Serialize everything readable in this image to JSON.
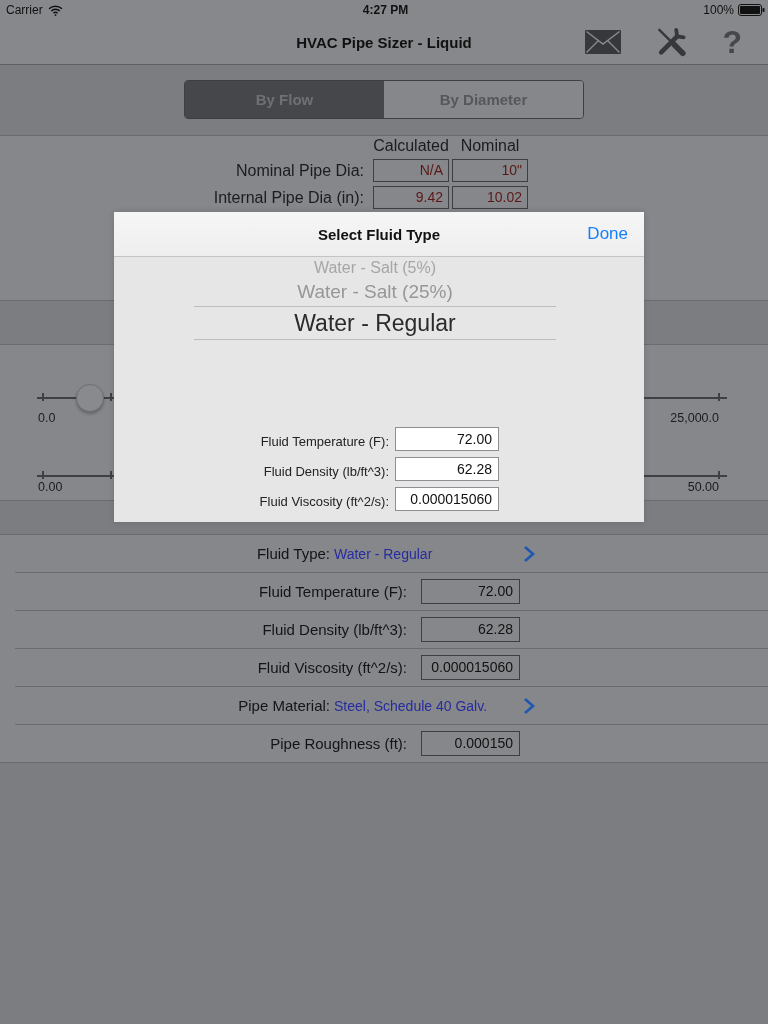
{
  "status_bar": {
    "carrier": "Carrier",
    "time": "4:27 PM",
    "battery": "100%"
  },
  "nav_bar": {
    "title": "HVAC Pipe Sizer - Liquid",
    "help_button": "?"
  },
  "mode_tabs": [
    {
      "label": "By Flow",
      "selected": true
    },
    {
      "label": "By Diameter",
      "selected": false
    }
  ],
  "diameter_table": {
    "columns": [
      "Calculated",
      "Nominal"
    ],
    "rows": [
      {
        "label": "Nominal Pipe Dia:",
        "cells": [
          "N/A",
          "10\""
        ]
      },
      {
        "label": "Internal Pipe Dia (in):",
        "cells": [
          "9.42",
          "10.02"
        ]
      }
    ]
  },
  "sliders": [
    {
      "level": 0.07,
      "min_label": "0.0",
      "max_label": "25,000.0"
    },
    {
      "min_label": "0.00",
      "max_label": "50.00"
    }
  ],
  "fluid_list": [
    {
      "kind": "link",
      "label": "Fluid Type:",
      "value": "Water - Regular"
    },
    {
      "kind": "field",
      "label": "Fluid Temperature (F):",
      "value": "72.00"
    },
    {
      "kind": "field",
      "label": "Fluid Density (lb/ft^3):",
      "value": "62.28"
    },
    {
      "kind": "field",
      "label": "Fluid Viscosity (ft^2/s):",
      "value": "0.000015060"
    },
    {
      "kind": "link",
      "label": "Pipe Material:",
      "value": "Steel, Schedule 40 Galv."
    },
    {
      "kind": "field",
      "label": "Pipe Roughness (ft):",
      "value": "0.000150"
    }
  ],
  "popover": {
    "title": "Select Fluid Type",
    "done_button": "Done",
    "picker": [
      {
        "label": "Water - Salt (5%)",
        "selected": false
      },
      {
        "label": "Water - Salt (25%)",
        "selected": false
      },
      {
        "label": "Water - Regular",
        "selected": true
      }
    ],
    "fields": [
      {
        "label": "Fluid Temperature (F):",
        "value": "72.00"
      },
      {
        "label": "Fluid Density (lb/ft^3):",
        "value": "62.28"
      },
      {
        "label": "Fluid Viscosity (ft^2/s):",
        "value": "0.000015060"
      }
    ]
  }
}
